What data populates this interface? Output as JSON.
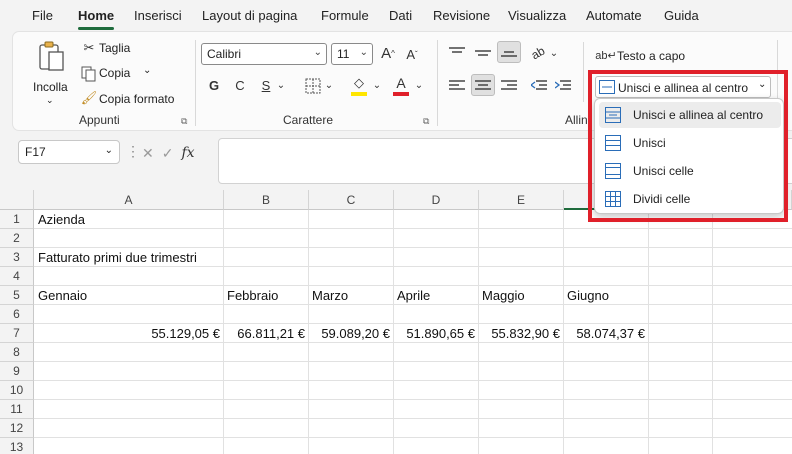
{
  "menu": {
    "tabs": [
      "File",
      "Home",
      "Inserisci",
      "Layout di pagina",
      "Formule",
      "Dati",
      "Revisione",
      "Visualizza",
      "Automate",
      "Guida"
    ],
    "active": "Home"
  },
  "ribbon": {
    "clipboard": {
      "paste_label": "Incolla",
      "cut_label": "Taglia",
      "copy_label": "Copia",
      "format_painter_label": "Copia formato",
      "group_label": "Appunti"
    },
    "font": {
      "font_name": "Calibri",
      "font_size": "11",
      "bold": "G",
      "italic": "C",
      "underline": "S",
      "group_label": "Carattere"
    },
    "alignment": {
      "wrap_text_label": "Testo a capo",
      "merge_center_label": "Unisci e allinea al centro",
      "group_label_partial": "Allin"
    }
  },
  "formula_bar": {
    "name_box": "F17",
    "fx": "fx",
    "content": ""
  },
  "sheet": {
    "columns": [
      "A",
      "B",
      "C",
      "D",
      "E"
    ],
    "rows": [
      "1",
      "2",
      "3",
      "4",
      "5",
      "6",
      "7",
      "8",
      "9",
      "10",
      "11",
      "12",
      "13"
    ],
    "cells": {
      "A1": "Azienda",
      "A3": "Fatturato primi due trimestri",
      "A5": "Gennaio",
      "B5": "Febbraio",
      "C5": "Marzo",
      "D5": "Aprile",
      "E5": "Maggio",
      "F5": "Giugno",
      "A7": "55.129,05 €",
      "B7": "66.811,21 €",
      "C7": "59.089,20 €",
      "D7": "51.890,65 €",
      "E7": "55.832,90 €",
      "F7": "58.074,37 €"
    }
  },
  "merge_menu": {
    "items": [
      "Unisci e allinea al centro",
      "Unisci",
      "Unisci celle",
      "Dividi celle"
    ]
  },
  "colors": {
    "accent_green": "#1e6b3c",
    "highlight_red": "#e0202a",
    "fill_yellow": "#ffe600",
    "font_red": "#e0202a"
  }
}
